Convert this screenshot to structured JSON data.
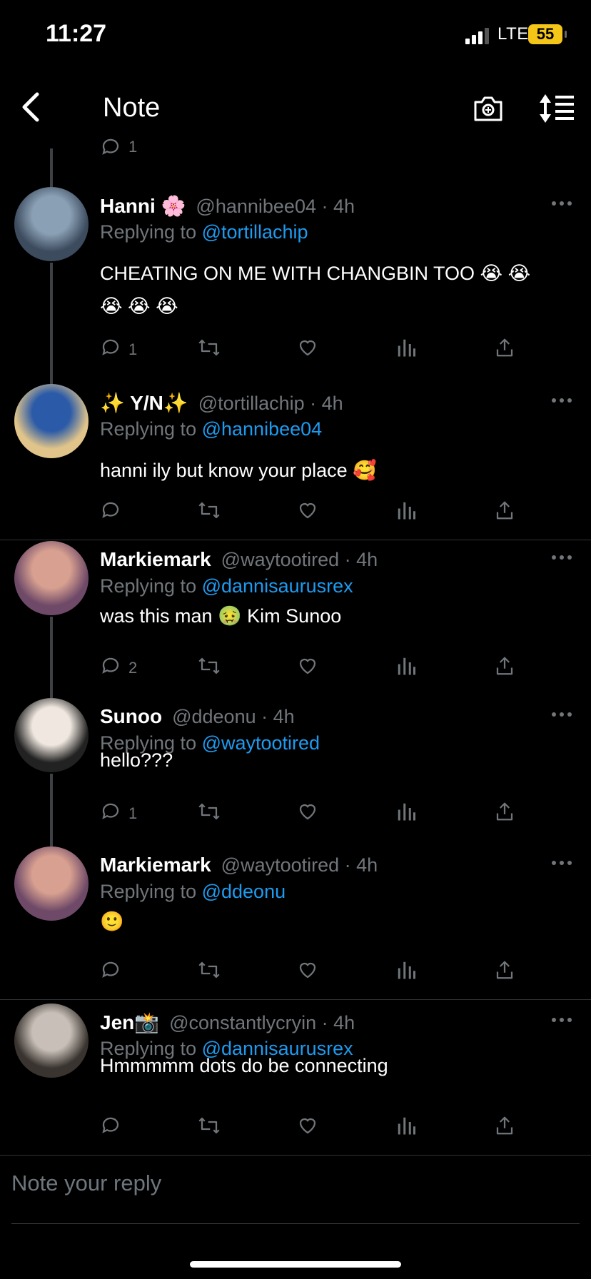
{
  "status": {
    "time": "11:27",
    "network": "LTE",
    "battery": "55"
  },
  "nav": {
    "title": "Note"
  },
  "top_partial": {
    "reply_count": "1"
  },
  "replies": [
    {
      "name": "Hanni 🌸",
      "handle": "@hannibee04 · 4h",
      "replying_prefix": "Replying to ",
      "replying_to": "@tortillachip",
      "text_line1": "CHEATING ON ME WITH CHANGBIN TOO 😭 😭",
      "text_line2": "😭 😭 😭",
      "reply_count": "1"
    },
    {
      "name": "✨ Y/N✨",
      "handle": "@tortillachip · 4h",
      "replying_prefix": "Replying to ",
      "replying_to": "@hannibee04",
      "text": "hanni ily but know your place 🥰",
      "reply_count": ""
    },
    {
      "name": "Markiemark",
      "handle": "@waytootired · 4h",
      "replying_prefix": "Replying to ",
      "replying_to": "@dannisaurusrex",
      "text": "was this man 🤢 Kim Sunoo",
      "reply_count": "2"
    },
    {
      "name": "Sunoo",
      "handle": "@ddeonu · 4h",
      "replying_prefix": "Replying to ",
      "replying_to": "@waytootired",
      "text": "hello???",
      "reply_count": "1"
    },
    {
      "name": "Markiemark",
      "handle": "@waytootired · 4h",
      "replying_prefix": "Replying to ",
      "replying_to": "@ddeonu",
      "text": "🙂",
      "reply_count": ""
    },
    {
      "name": "Jen📸",
      "handle": "@constantlycryin · 4h",
      "replying_prefix": "Replying to ",
      "replying_to": "@dannisaurusrex",
      "text": "Hmmmmm dots do be connecting",
      "reply_count": ""
    }
  ],
  "composer": {
    "placeholder": "Note your reply"
  },
  "icons": [
    "back-icon",
    "camera-icon",
    "sort-icon",
    "reply-icon",
    "retweet-icon",
    "like-icon",
    "views-icon",
    "share-icon",
    "more-icon"
  ],
  "colors": {
    "background": "#000000",
    "accent": "#1d9bf0",
    "muted": "#71767b",
    "battery": "#f5c518"
  }
}
